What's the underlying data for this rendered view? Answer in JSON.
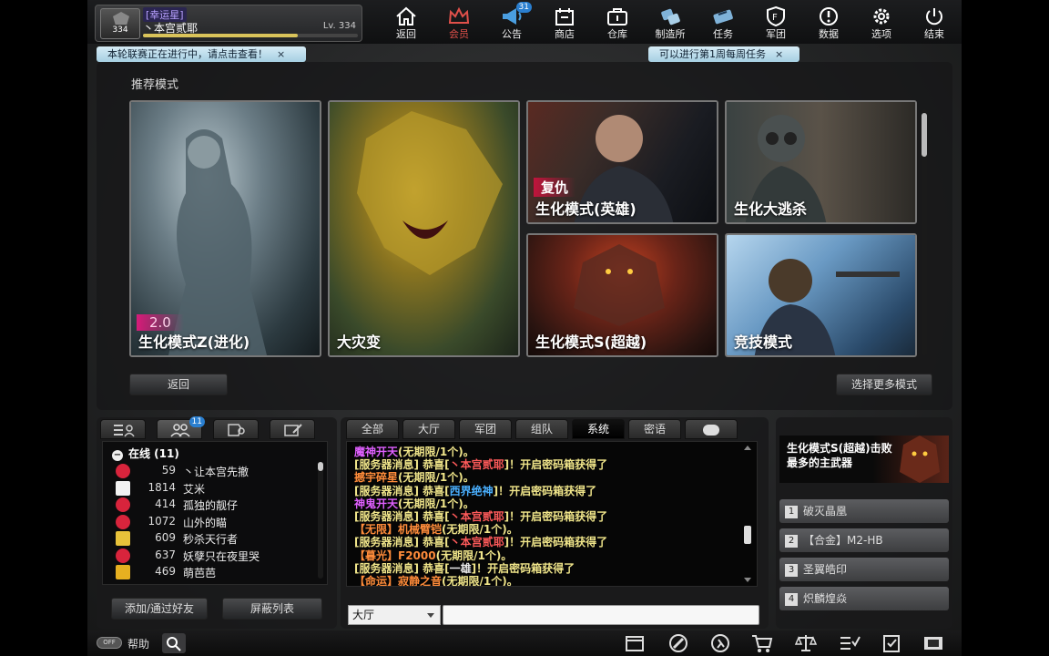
{
  "profile": {
    "guild": "[幸运星]",
    "name": "丶本宫贰耶",
    "level_text": "Lv. 334",
    "avatar_level": "334",
    "xp_fraction": 0.72
  },
  "nav": [
    {
      "label": "返回",
      "icon": "home-icon"
    },
    {
      "label": "会员",
      "icon": "crown-icon"
    },
    {
      "label": "公告",
      "icon": "megaphone-icon",
      "badge": "31"
    },
    {
      "label": "商店",
      "icon": "shop-icon"
    },
    {
      "label": "仓库",
      "icon": "briefcase-icon"
    },
    {
      "label": "制造所",
      "icon": "craft-icon"
    },
    {
      "label": "任务",
      "icon": "ticket-icon"
    },
    {
      "label": "军团",
      "icon": "shield-icon"
    },
    {
      "label": "数据",
      "icon": "alert-icon"
    },
    {
      "label": "选项",
      "icon": "gear-icon"
    },
    {
      "label": "结束",
      "icon": "power-icon"
    }
  ],
  "notices": {
    "left": "本轮联赛正在进行中，请点击查看！",
    "right": "可以进行第1周每周任务",
    "close": "×"
  },
  "modes": {
    "title": "推荐模式",
    "cards": [
      {
        "caption": "生化模式Z(进化)",
        "version": "2.0"
      },
      {
        "caption": "大灾变"
      },
      {
        "caption": "生化模式(英雄)",
        "tag": "复仇"
      },
      {
        "caption": "生化大逃杀"
      },
      {
        "caption": "生化模式S(超越)"
      },
      {
        "caption": "竞技模式"
      }
    ],
    "back": "返回",
    "more": "选择更多模式"
  },
  "friends": {
    "tab_badge": "11",
    "online_label": "在线 (11)",
    "list": [
      {
        "level": "59",
        "name": "丶让本宫先撤",
        "icon": "rose"
      },
      {
        "level": "1814",
        "name": "艾米",
        "icon": "bow"
      },
      {
        "level": "414",
        "name": "孤独的靓仔",
        "icon": "rose"
      },
      {
        "level": "1072",
        "name": "山外的瞄",
        "icon": "rose"
      },
      {
        "level": "609",
        "name": "秒杀天行者",
        "icon": "check"
      },
      {
        "level": "637",
        "name": "妖孽只在夜里哭",
        "icon": "rose"
      },
      {
        "level": "469",
        "name": "萌芭芭",
        "icon": "crown"
      }
    ],
    "add_button": "添加/通过好友",
    "block_button": "屏蔽列表"
  },
  "chat": {
    "tabs": [
      "全部",
      "大厅",
      "军团",
      "组队",
      "系统",
      "密语"
    ],
    "active_tab": "系统",
    "lines": [
      {
        "parts": [
          {
            "t": "魔神开天",
            "c": "#e060ff"
          },
          {
            "t": "(无期限/1个)。",
            "c": "#f0e58a"
          }
        ]
      },
      {
        "parts": [
          {
            "t": "[服务器消息] 恭喜[",
            "c": "#f0e58a"
          },
          {
            "t": "丶本宫贰耶",
            "c": "#ff5a5a"
          },
          {
            "t": "]！开启密码箱获得了",
            "c": "#f0e58a"
          }
        ]
      },
      {
        "parts": [
          {
            "t": "撼宇碎星",
            "c": "#ff8c3a"
          },
          {
            "t": "(无期限/1个)。",
            "c": "#f0e58a"
          }
        ]
      },
      {
        "parts": [
          {
            "t": "[服务器消息] 恭喜[",
            "c": "#f0e58a"
          },
          {
            "t": "西界绝神",
            "c": "#4ab0ff"
          },
          {
            "t": "]！开启密码箱获得了",
            "c": "#f0e58a"
          }
        ]
      },
      {
        "parts": [
          {
            "t": "神鬼开天",
            "c": "#e060ff"
          },
          {
            "t": "(无期限/1个)。",
            "c": "#f0e58a"
          }
        ]
      },
      {
        "parts": [
          {
            "t": "[服务器消息] 恭喜[",
            "c": "#f0e58a"
          },
          {
            "t": "丶本宫贰耶",
            "c": "#ff5a5a"
          },
          {
            "t": "]！开启密码箱获得了",
            "c": "#f0e58a"
          }
        ]
      },
      {
        "parts": [
          {
            "t": "【无限】机械臂铠",
            "c": "#ff8c3a"
          },
          {
            "t": "(无期限/1个)。",
            "c": "#f0e58a"
          }
        ]
      },
      {
        "parts": [
          {
            "t": "[服务器消息] 恭喜[",
            "c": "#f0e58a"
          },
          {
            "t": "丶本宫贰耶",
            "c": "#ff5a5a"
          },
          {
            "t": "]！开启密码箱获得了",
            "c": "#f0e58a"
          }
        ]
      },
      {
        "parts": [
          {
            "t": "【暮光】F2000",
            "c": "#ff8c3a"
          },
          {
            "t": "(无期限/1个)。",
            "c": "#f0e58a"
          }
        ]
      },
      {
        "parts": [
          {
            "t": "[服务器消息] 恭喜[",
            "c": "#f0e58a"
          },
          {
            "t": "一雄",
            "c": "#e8e8e8"
          },
          {
            "t": "]！开启密码箱获得了",
            "c": "#f0e58a"
          }
        ]
      },
      {
        "parts": [
          {
            "t": "【命运】寂静之音",
            "c": "#ff8c3a"
          },
          {
            "t": "(无期限/1个)。",
            "c": "#f0e58a"
          }
        ]
      }
    ],
    "channel": "大厅",
    "input_value": ""
  },
  "weapons": {
    "title": "生化模式S(超越)击败最多的主武器",
    "items": [
      {
        "rank": "1",
        "name": "破灭晶凰"
      },
      {
        "rank": "2",
        "name": "【合金】M2-HB"
      },
      {
        "rank": "3",
        "name": "圣翼皓印"
      },
      {
        "rank": "4",
        "name": "炽麟煌焱"
      }
    ]
  },
  "bottom": {
    "help": "帮助",
    "toggle": "OFF"
  }
}
